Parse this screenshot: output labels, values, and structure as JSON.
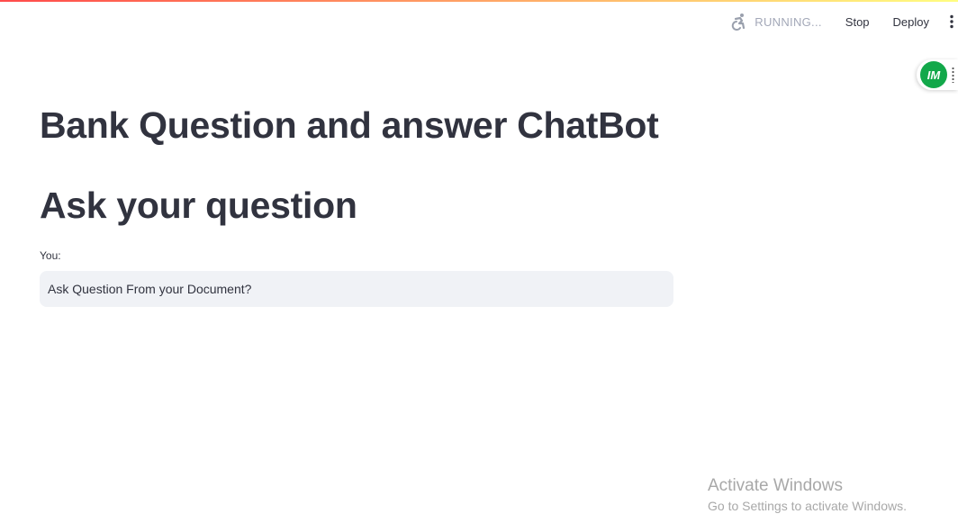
{
  "header": {
    "status_text": "RUNNING...",
    "stop_label": "Stop",
    "deploy_label": "Deploy",
    "status_icon": "swimmer-running-icon",
    "menu_icon": "vertical-ellipsis-icon"
  },
  "extension": {
    "logo_text": "IM",
    "logo_color": "#12a84a"
  },
  "main": {
    "title": "Bank Question and answer ChatBot",
    "subtitle": "Ask your question",
    "input_label": "You:",
    "input_value": "Ask Question From your Document?"
  },
  "watermark": {
    "title": "Activate Windows",
    "subtitle": "Go to Settings to activate Windows."
  },
  "colors": {
    "text": "#31333f",
    "input_bg": "#f0f2f6",
    "status_gray": "#a3a8b8",
    "decoration_start": "#ff4b4b",
    "decoration_end": "#fffd80"
  }
}
